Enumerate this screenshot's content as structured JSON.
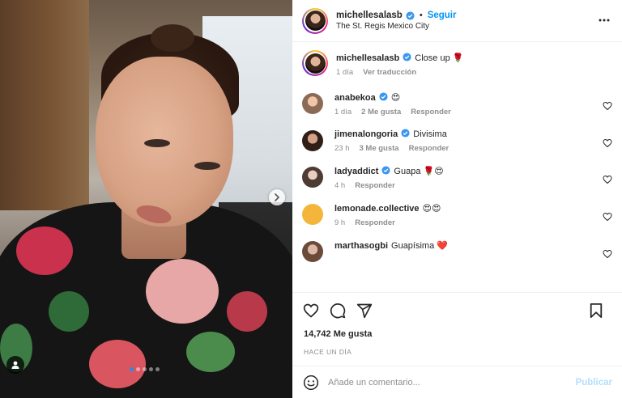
{
  "post": {
    "author": "michellesalasb",
    "follow_label": "Seguir",
    "dot": "•",
    "location": "The St. Regis Mexico City"
  },
  "caption": {
    "username": "michellesalasb",
    "text": "Close up",
    "emoji": "🌹",
    "time": "1 día",
    "translate": "Ver traducción"
  },
  "comments": [
    {
      "username": "anabekoa",
      "verified": true,
      "text": "",
      "emoji": "😍",
      "time": "1 día",
      "likes": "2 Me gusta",
      "reply": "Responder"
    },
    {
      "username": "jimenalongoria",
      "verified": true,
      "text": "Divisima",
      "emoji": "",
      "time": "23 h",
      "likes": "3 Me gusta",
      "reply": "Responder"
    },
    {
      "username": "ladyaddict",
      "verified": true,
      "text": "Guapa",
      "emoji": "🌹😍",
      "time": "4 h",
      "likes": "",
      "reply": "Responder"
    },
    {
      "username": "lemonade.collective",
      "verified": false,
      "text": "",
      "emoji": "😍😍",
      "time": "9 h",
      "likes": "",
      "reply": "Responder"
    },
    {
      "username": "marthasogbi",
      "verified": false,
      "text": "Guapísima",
      "emoji": "❤️",
      "time": "",
      "likes": "",
      "reply": ""
    }
  ],
  "likes_count": "14,742 Me gusta",
  "posted_ago": "HACE UN DÍA",
  "comment_box": {
    "placeholder": "Añade un comentario...",
    "publish_label": "Publicar"
  },
  "carousel": {
    "slides": 5,
    "active": 0
  },
  "colors": {
    "accent": "#0095f6",
    "publish_disabled": "#b2dffc",
    "verified": "#3897f0"
  }
}
